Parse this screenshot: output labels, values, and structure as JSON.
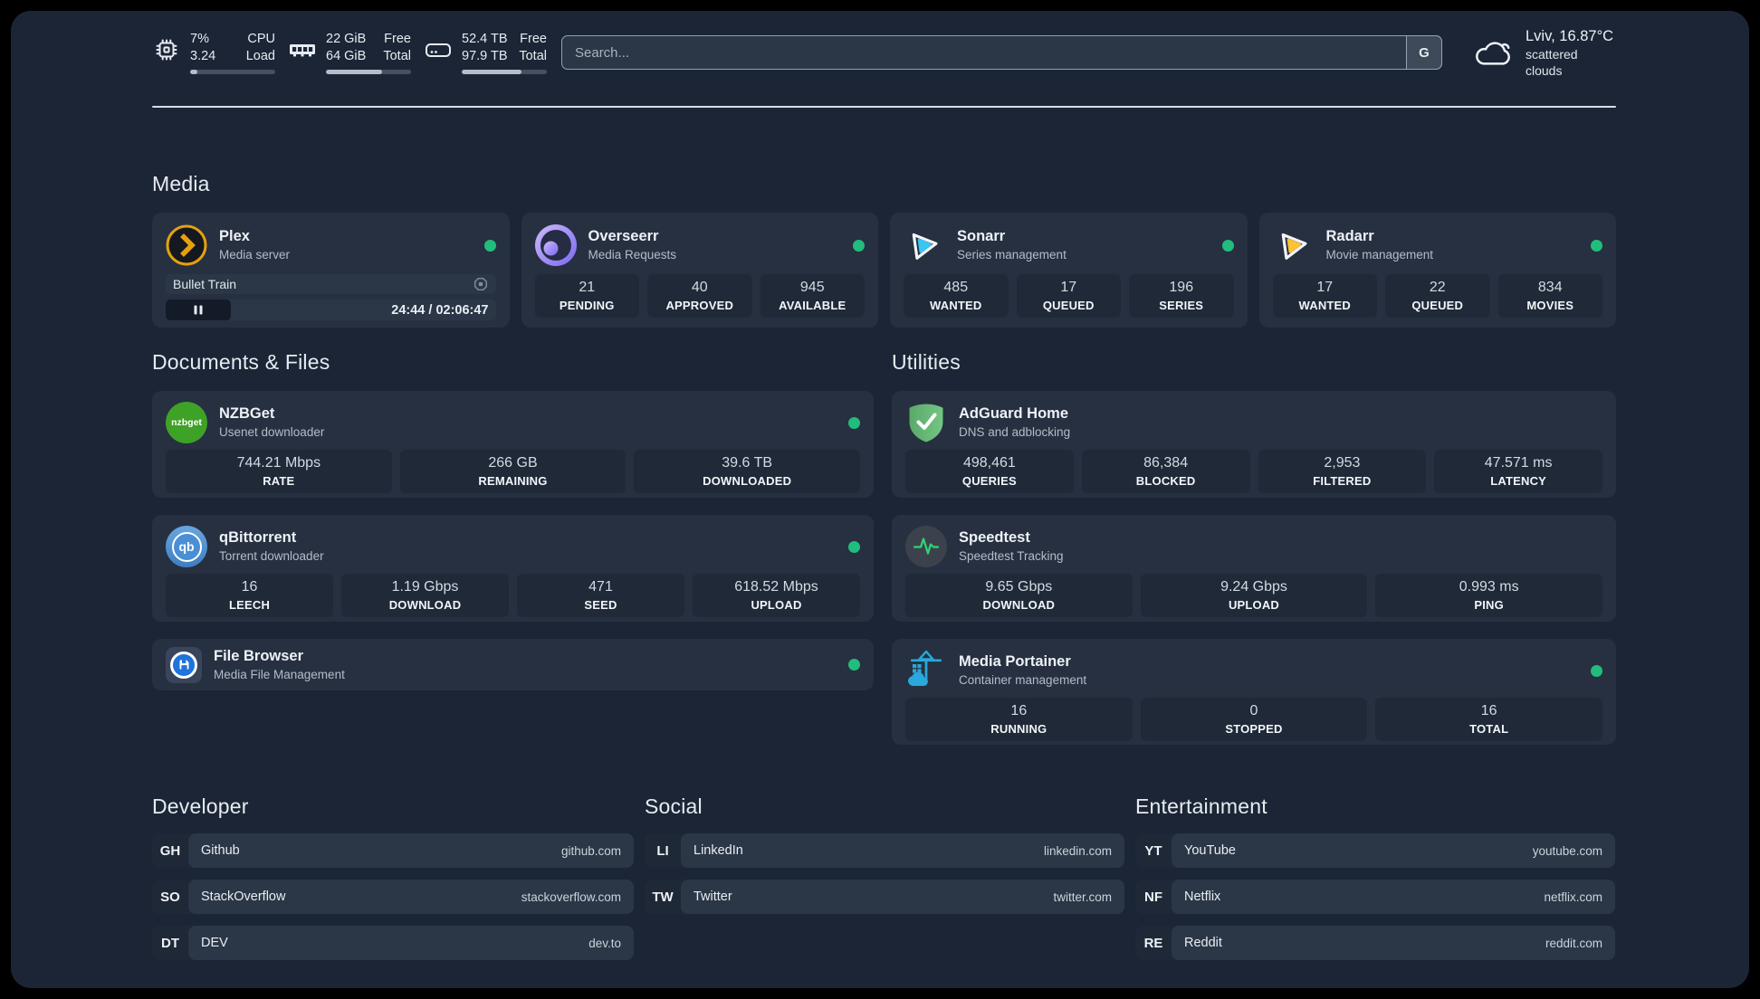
{
  "colors": {
    "status_online": "#22bd7c",
    "plex": "#e5a00d",
    "sonarr": "#38c6f4",
    "radarr": "#fec232",
    "nzbget": "#3ea226",
    "qbittorrent": "#4a8fd6",
    "adguard": "#66b574",
    "speedtest_pulse": "#2ed573",
    "portainer": "#29a8dc",
    "filebrowser": "#2173dc"
  },
  "header": {
    "cpu": {
      "value1": "7%",
      "label1": "CPU",
      "value2": "3.24",
      "label2": "Load",
      "progress": 8
    },
    "memory": {
      "value1": "22 GiB",
      "label1": "Free",
      "value2": "64 GiB",
      "label2": "Total",
      "progress": 66
    },
    "storage": {
      "value1": "52.4 TB",
      "label1": "Free",
      "value2": "97.9 TB",
      "label2": "Total",
      "progress": 70
    },
    "search": {
      "placeholder": "Search...",
      "button": "G"
    },
    "weather": {
      "location": "Lviv, 16.87°C",
      "condition": "scattered clouds"
    }
  },
  "media": {
    "title": "Media",
    "plex": {
      "title": "Plex",
      "subtitle": "Media server",
      "now_playing": "Bullet Train",
      "time": "24:44 / 02:06:47"
    },
    "overseerr": {
      "title": "Overseerr",
      "subtitle": "Media Requests",
      "stats": [
        {
          "value": "21",
          "label": "PENDING"
        },
        {
          "value": "40",
          "label": "APPROVED"
        },
        {
          "value": "945",
          "label": "AVAILABLE"
        }
      ]
    },
    "sonarr": {
      "title": "Sonarr",
      "subtitle": "Series management",
      "stats": [
        {
          "value": "485",
          "label": "WANTED"
        },
        {
          "value": "17",
          "label": "QUEUED"
        },
        {
          "value": "196",
          "label": "SERIES"
        }
      ]
    },
    "radarr": {
      "title": "Radarr",
      "subtitle": "Movie management",
      "stats": [
        {
          "value": "17",
          "label": "WANTED"
        },
        {
          "value": "22",
          "label": "QUEUED"
        },
        {
          "value": "834",
          "label": "MOVIES"
        }
      ]
    }
  },
  "documents": {
    "title": "Documents & Files",
    "nzbget": {
      "title": "NZBGet",
      "subtitle": "Usenet downloader",
      "icon_text": "nzbget",
      "stats": [
        {
          "value": "744.21 Mbps",
          "label": "RATE"
        },
        {
          "value": "266 GB",
          "label": "REMAINING"
        },
        {
          "value": "39.6 TB",
          "label": "DOWNLOADED"
        }
      ]
    },
    "qbittorrent": {
      "title": "qBittorrent",
      "subtitle": "Torrent downloader",
      "icon_text": "qb",
      "stats": [
        {
          "value": "16",
          "label": "LEECH"
        },
        {
          "value": "1.19 Gbps",
          "label": "DOWNLOAD"
        },
        {
          "value": "471",
          "label": "SEED"
        },
        {
          "value": "618.52 Mbps",
          "label": "UPLOAD"
        }
      ]
    },
    "filebrowser": {
      "title": "File Browser",
      "subtitle": "Media File Management"
    }
  },
  "utilities": {
    "title": "Utilities",
    "adguard": {
      "title": "AdGuard Home",
      "subtitle": "DNS and adblocking",
      "stats": [
        {
          "value": "498,461",
          "label": "QUERIES"
        },
        {
          "value": "86,384",
          "label": "BLOCKED"
        },
        {
          "value": "2,953",
          "label": "FILTERED"
        },
        {
          "value": "47.571 ms",
          "label": "LATENCY"
        }
      ]
    },
    "speedtest": {
      "title": "Speedtest",
      "subtitle": "Speedtest Tracking",
      "stats": [
        {
          "value": "9.65 Gbps",
          "label": "DOWNLOAD"
        },
        {
          "value": "9.24 Gbps",
          "label": "UPLOAD"
        },
        {
          "value": "0.993 ms",
          "label": "PING"
        }
      ]
    },
    "portainer": {
      "title": "Media Portainer",
      "subtitle": "Container management",
      "stats": [
        {
          "value": "16",
          "label": "RUNNING"
        },
        {
          "value": "0",
          "label": "STOPPED"
        },
        {
          "value": "16",
          "label": "TOTAL"
        }
      ]
    }
  },
  "links": {
    "developer": {
      "title": "Developer",
      "items": [
        {
          "tag": "GH",
          "name": "Github",
          "url": "github.com"
        },
        {
          "tag": "SO",
          "name": "StackOverflow",
          "url": "stackoverflow.com"
        },
        {
          "tag": "DT",
          "name": "DEV",
          "url": "dev.to"
        }
      ]
    },
    "social": {
      "title": "Social",
      "items": [
        {
          "tag": "LI",
          "name": "LinkedIn",
          "url": "linkedin.com"
        },
        {
          "tag": "TW",
          "name": "Twitter",
          "url": "twitter.com"
        }
      ]
    },
    "entertainment": {
      "title": "Entertainment",
      "items": [
        {
          "tag": "YT",
          "name": "YouTube",
          "url": "youtube.com"
        },
        {
          "tag": "NF",
          "name": "Netflix",
          "url": "netflix.com"
        },
        {
          "tag": "RE",
          "name": "Reddit",
          "url": "reddit.com"
        }
      ]
    }
  }
}
